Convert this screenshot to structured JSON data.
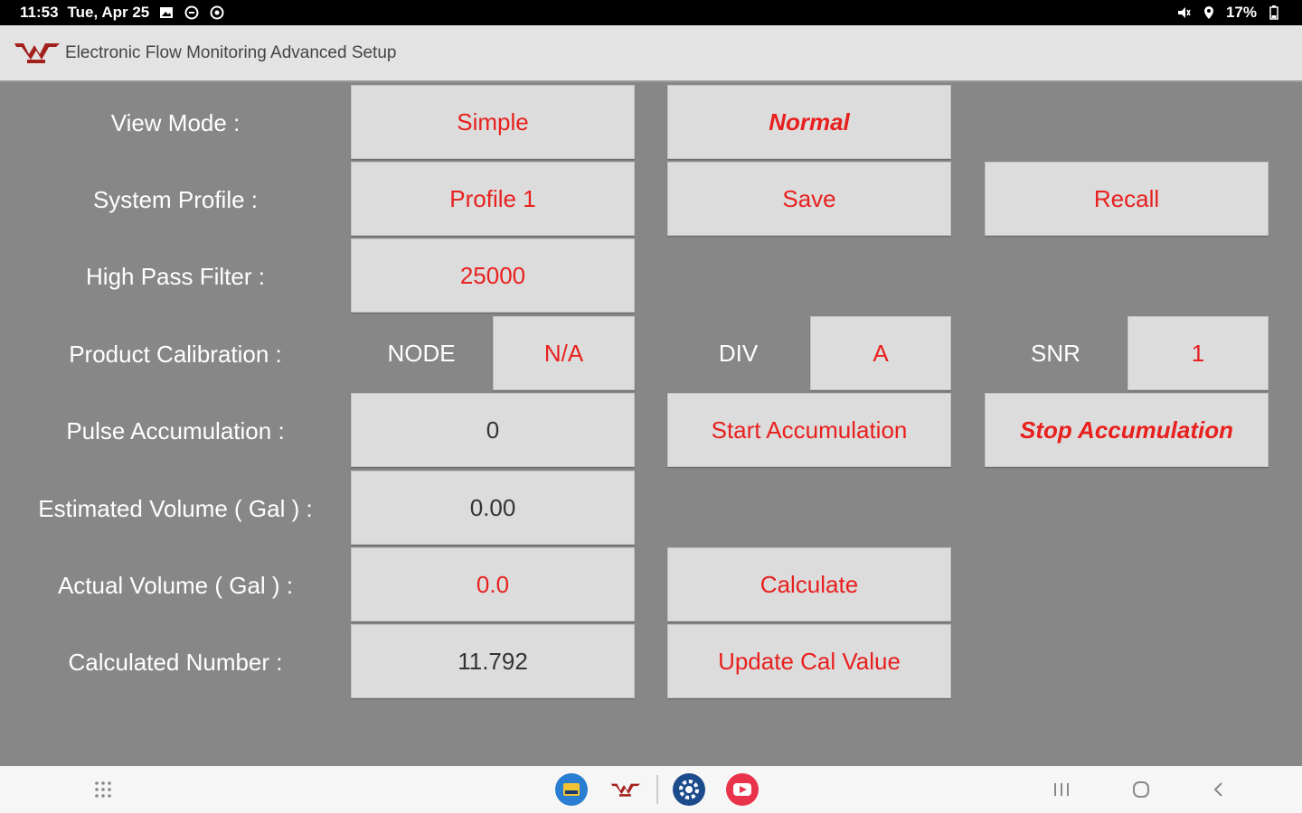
{
  "status_bar": {
    "time": "11:53",
    "date": "Tue, Apr 25",
    "battery": "17%",
    "left_icons": [
      "gallery-icon",
      "sync-icon",
      "settings-status-icon"
    ],
    "right_icons": [
      "mute-icon",
      "location-icon",
      "battery-icon"
    ]
  },
  "app_bar": {
    "title": "Electronic Flow Monitoring Advanced Setup",
    "logo_icon": "app-logo-icon"
  },
  "form": {
    "view_mode": {
      "label": "View Mode :",
      "value": "Simple",
      "mode": "Normal"
    },
    "system_profile": {
      "label": "System Profile :",
      "value": "Profile 1",
      "save": "Save",
      "recall": "Recall"
    },
    "high_pass_filter": {
      "label": "High Pass Filter :",
      "value": "25000"
    },
    "product_calibration": {
      "label": "Product Calibration :",
      "node_label": "NODE",
      "node_value": "N/A",
      "div_label": "DIV",
      "div_value": "A",
      "snr_label": "SNR",
      "snr_value": "1"
    },
    "pulse_accumulation": {
      "label": "Pulse Accumulation :",
      "value": "0",
      "start": "Start Accumulation",
      "stop": "Stop Accumulation"
    },
    "estimated_volume": {
      "label": "Estimated Volume ( Gal ) :",
      "value": "0.00"
    },
    "actual_volume": {
      "label": "Actual Volume ( Gal ) :",
      "value": "0.0",
      "calculate": "Calculate"
    },
    "calculated_number": {
      "label": "Calculated Number :",
      "value": "11.792",
      "update": "Update Cal Value"
    }
  },
  "nav_bar": {
    "apps": [
      "apps-grid-icon",
      "flow-app-icon",
      "wilger-app-icon",
      "settings-app-icon",
      "youtube-app-icon"
    ],
    "buttons": [
      "recents-icon",
      "home-icon",
      "back-icon"
    ]
  },
  "colors": {
    "background": "#878787",
    "button": "#dcdcdc",
    "accent_text": "#e8201e",
    "label_text": "#ffffff",
    "app_bar": "#e3e3e3"
  }
}
